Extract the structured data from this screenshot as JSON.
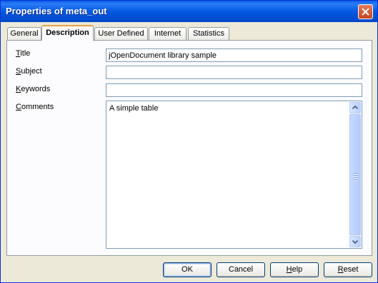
{
  "window": {
    "title": "Properties of meta_out"
  },
  "tabs": [
    {
      "label": "General"
    },
    {
      "label": "Description",
      "active": true
    },
    {
      "label": "User Defined"
    },
    {
      "label": "Internet"
    },
    {
      "label": "Statistics"
    }
  ],
  "form": {
    "title": {
      "label_prefix": "",
      "label_mnemonic": "T",
      "label_rest": "itle",
      "value": "jOpenDocument library sample"
    },
    "subject": {
      "label_prefix": "",
      "label_mnemonic": "S",
      "label_rest": "ubject",
      "value": ""
    },
    "keywords": {
      "label_prefix": "",
      "label_mnemonic": "K",
      "label_rest": "eywords",
      "value": ""
    },
    "comments": {
      "label_prefix": "",
      "label_mnemonic": "C",
      "label_rest": "omments",
      "value": "A simple table"
    }
  },
  "buttons": {
    "ok": "OK",
    "cancel": "Cancel",
    "help_mnemonic": "H",
    "help_rest": "elp",
    "reset_mnemonic": "R",
    "reset_rest": "eset"
  },
  "colors": {
    "titlebar": "#0358e0",
    "tab_highlight": "#e7a23f",
    "dialog_bg": "#ece9d8"
  }
}
